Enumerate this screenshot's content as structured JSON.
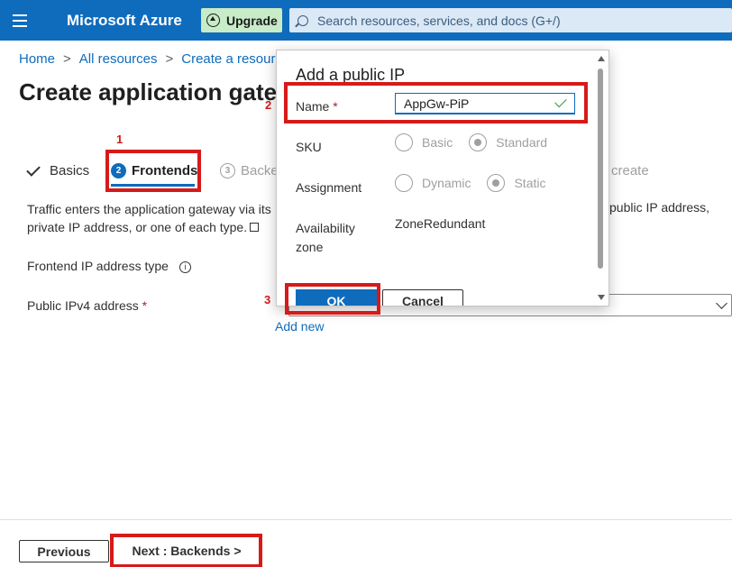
{
  "topbar": {
    "brand": "Microsoft Azure",
    "upgrade_label": "Upgrade",
    "search_placeholder": "Search resources, services, and docs (G+/)"
  },
  "breadcrumb": [
    "Home",
    "All resources",
    "Create a resourc"
  ],
  "page_title": "Create application gatew",
  "steps": [
    {
      "num": "",
      "label": "Basics"
    },
    {
      "num": "2",
      "label": "Frontends"
    },
    {
      "num": "3",
      "label": "Backe"
    },
    {
      "num": "",
      "label": "create"
    }
  ],
  "description": {
    "left": "Traffic enters the application gateway via its",
    "line2": "private IP address, or one of each type.",
    "right": "public IP address,"
  },
  "form": {
    "frontend_ip_type_label": "Frontend IP address type",
    "info_glyph": "i",
    "public_ipv4_label": "Public IPv4 address",
    "required_mark": "*",
    "add_new_label": "Add new"
  },
  "footer": {
    "previous_label": "Previous",
    "next_label": "Next : Backends >"
  },
  "annotations": [
    "1",
    "2",
    "3"
  ],
  "modal": {
    "title": "Add a public IP",
    "name_label": "Name",
    "required_mark": "*",
    "name_value": "AppGw-PiP",
    "sku_label": "SKU",
    "sku_options": [
      "Basic",
      "Standard"
    ],
    "sku_selected": "Standard",
    "assignment_label": "Assignment",
    "assignment_options": [
      "Dynamic",
      "Static"
    ],
    "assignment_selected": "Static",
    "availability_label_1": "Availability",
    "availability_label_2": "zone",
    "availability_value": "ZoneRedundant",
    "ok_label": "OK",
    "cancel_label": "Cancel"
  },
  "colors": {
    "azure_blue": "#0f6cbd",
    "annotation_red": "#d61a1a",
    "upgrade_green": "#c8ebc8"
  }
}
